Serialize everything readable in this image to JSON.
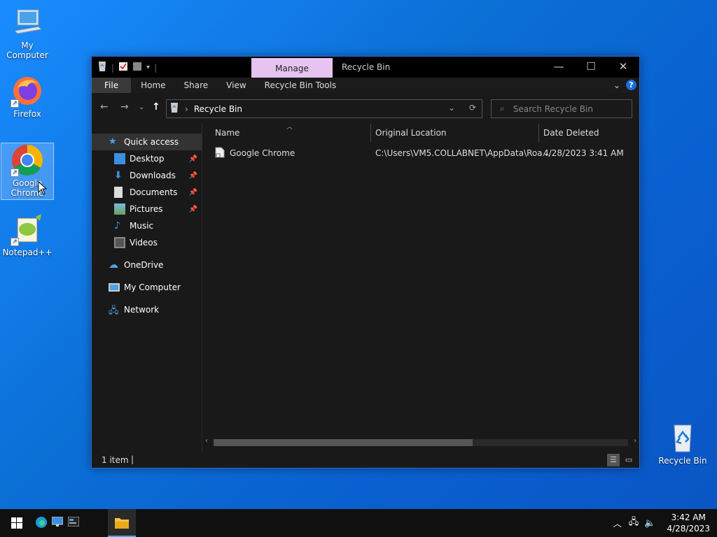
{
  "desktop": {
    "icons": [
      {
        "label": "My Computer"
      },
      {
        "label": "Firefox"
      },
      {
        "label": "Google Chrome"
      },
      {
        "label": "Notepad++"
      },
      {
        "label": "Recycle Bin"
      }
    ]
  },
  "window": {
    "title": "Recycle Bin",
    "manage_tab": "Manage",
    "ribbon_tabs": [
      "File",
      "Home",
      "Share",
      "View",
      "Recycle Bin Tools"
    ],
    "address_path": "Recycle Bin",
    "search_placeholder": "Search Recycle Bin",
    "nav": {
      "quick_access": "Quick access",
      "quick_items": [
        {
          "label": "Desktop",
          "pinned": true
        },
        {
          "label": "Downloads",
          "pinned": true
        },
        {
          "label": "Documents",
          "pinned": true
        },
        {
          "label": "Pictures",
          "pinned": true
        },
        {
          "label": "Music",
          "pinned": false
        },
        {
          "label": "Videos",
          "pinned": false
        }
      ],
      "onedrive": "OneDrive",
      "my_computer": "My Computer",
      "network": "Network"
    },
    "columns": [
      "Name",
      "Original Location",
      "Date Deleted"
    ],
    "files": [
      {
        "name": "Google Chrome",
        "original_location": "C:\\Users\\VM5.COLLABNET\\AppData\\Roa...",
        "date_deleted": "4/28/2023 3:41 AM"
      }
    ],
    "status": {
      "item_count": "1 item"
    }
  },
  "taskbar": {
    "clock_time": "3:42 AM",
    "clock_date": "4/28/2023"
  },
  "colors": {
    "manage_tab_bg": "#e6c3f0",
    "window_bg": "#191919",
    "accent": "#1a6ed8"
  }
}
